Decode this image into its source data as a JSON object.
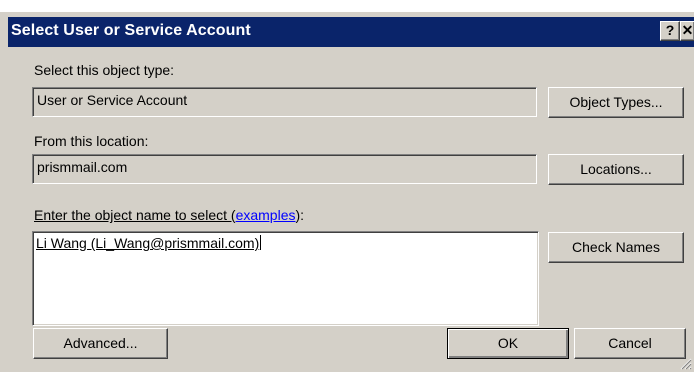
{
  "dialog": {
    "title": "Select User or Service Account",
    "help_glyph": "?",
    "close_glyph": "✕"
  },
  "object_type": {
    "label": "Select this object type:",
    "value": "User or Service Account",
    "button": "Object Types..."
  },
  "location": {
    "label": "From this location:",
    "value": "prismmail.com",
    "button": "Locations..."
  },
  "names": {
    "label_prefix": "Enter the object name to select (",
    "label_link": "examples",
    "label_suffix": "):",
    "value": "Li Wang (Li_Wang@prismmail.com)",
    "check_button": "Check Names"
  },
  "buttons": {
    "advanced": "Advanced...",
    "ok": "OK",
    "cancel": "Cancel"
  },
  "colors": {
    "titlebar": "#0a246a",
    "dialog_bg": "#d4d0c8",
    "link": "#0000ff"
  }
}
